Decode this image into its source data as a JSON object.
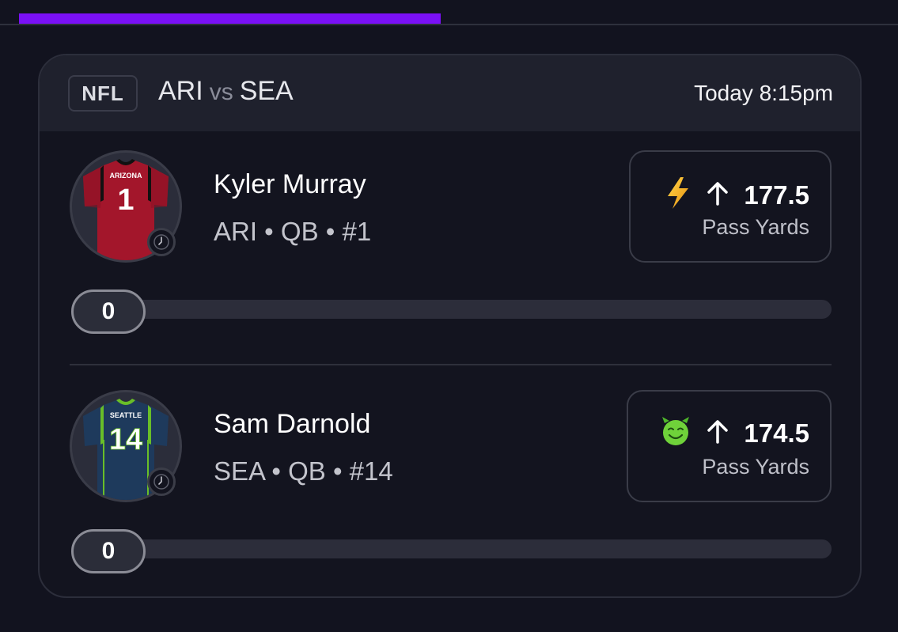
{
  "progress_bar": {
    "fill_percent": 48,
    "color": "#7a10f5"
  },
  "game": {
    "league": "NFL",
    "away_team": "ARI",
    "vs": "vs",
    "home_team": "SEA",
    "time": "Today 8:15pm"
  },
  "players": [
    {
      "name": "Kyler Murray",
      "meta": "ARI • QB • #1",
      "jersey_text": "ARIZONA",
      "jersey_number": "1",
      "jersey_color": "#a3162b",
      "trim_color": "#111111",
      "badge_icon": "lightning-bolt-icon",
      "direction_icon": "arrow-up-icon",
      "line": "177.5",
      "stat": "Pass Yards",
      "progress_value": "0",
      "progress_fraction": 0
    },
    {
      "name": "Sam Darnold",
      "meta": "SEA • QB • #14",
      "jersey_text": "SEATTLE",
      "jersey_number": "14",
      "jersey_color": "#1e3a5c",
      "trim_color": "#69be28",
      "badge_icon": "smiling-devil-icon",
      "direction_icon": "arrow-up-icon",
      "line": "174.5",
      "stat": "Pass Yards",
      "progress_value": "0",
      "progress_fraction": 0
    }
  ]
}
